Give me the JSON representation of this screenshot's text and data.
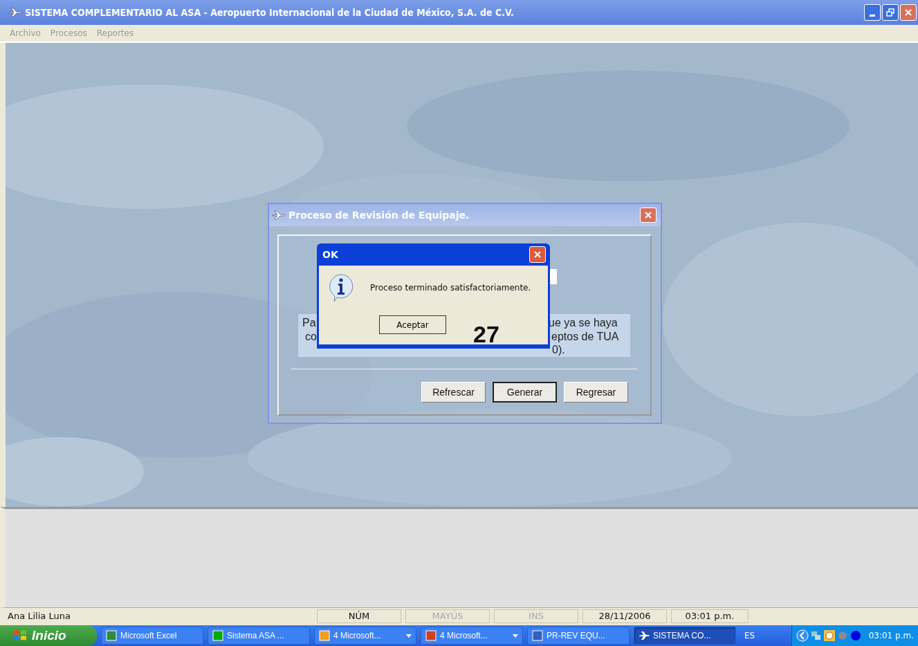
{
  "window": {
    "title": "SISTEMA COMPLEMENTARIO AL ASA - Aeropuerto Internacional de la Ciudad de México, S.A. de C.V."
  },
  "menu": [
    "Archivo",
    "Procesos",
    "Reportes"
  ],
  "dialog": {
    "title": "Proceso de Revisión de Equipaje.",
    "text_left": [
      "Pa",
      "co"
    ],
    "text_right": [
      "ue ya se haya",
      "eptos de TUA"
    ],
    "text_bottom": "0).",
    "buttons": [
      {
        "label": "Refrescar",
        "default": false
      },
      {
        "label": "Generar",
        "default": true
      },
      {
        "label": "Regresar",
        "default": false
      }
    ]
  },
  "message_box": {
    "title": "OK",
    "message": "Proceso terminado satisfactoriamente.",
    "button": "Aceptar"
  },
  "annotation": "27",
  "status_bar": [
    {
      "text": "Ana Lilia Luna",
      "enabled": true
    },
    {
      "text": "NÚM",
      "enabled": true
    },
    {
      "text": "MAYÚS",
      "enabled": false
    },
    {
      "text": "INS",
      "enabled": false
    },
    {
      "text": "28/11/2006",
      "enabled": true
    },
    {
      "text": "03:01 p.m.",
      "enabled": true
    }
  ],
  "taskbar": {
    "start": "Inicio",
    "items": [
      {
        "label": "Microsoft Excel",
        "kind": "excel",
        "group": false,
        "selected": false
      },
      {
        "label": "Sistema ASA ...",
        "kind": "asa",
        "group": false,
        "selected": false
      },
      {
        "label": "4 Microsoft...",
        "kind": "clock",
        "group": true,
        "selected": false
      },
      {
        "label": "4 Microsoft...",
        "kind": "slides",
        "group": true,
        "selected": false
      },
      {
        "label": "PR-REV EQU...",
        "kind": "word",
        "group": false,
        "selected": false
      },
      {
        "label": "SISTEMA CO...",
        "kind": "plane",
        "group": false,
        "selected": true
      }
    ],
    "language": "ES",
    "clock": "03:01 p.m."
  }
}
